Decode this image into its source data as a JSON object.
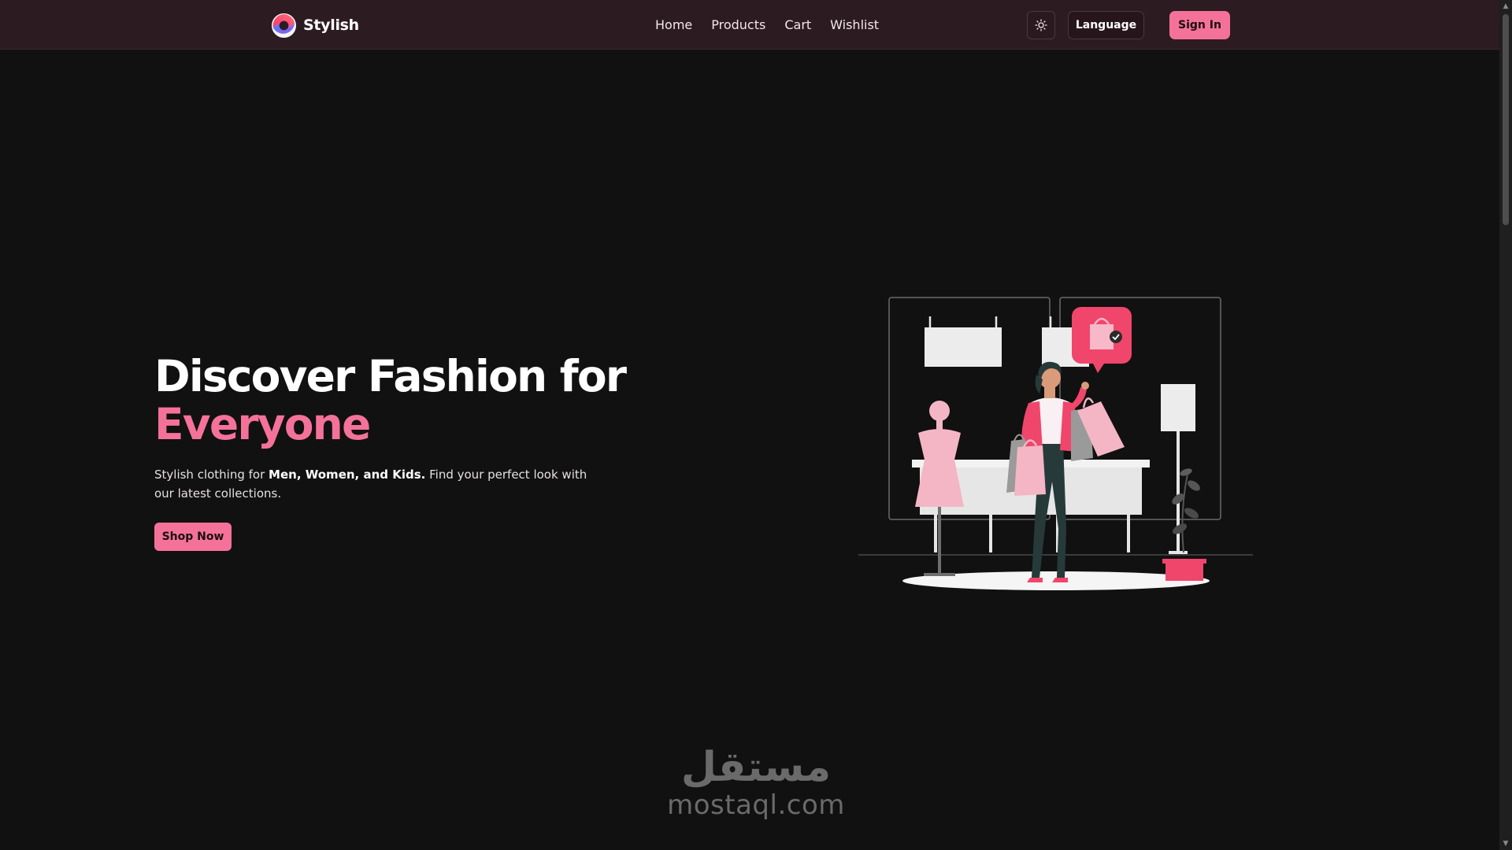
{
  "brand": {
    "name": "Stylish",
    "logo_icon": "stylish-logo-icon"
  },
  "nav": {
    "items": [
      {
        "label": "Home"
      },
      {
        "label": "Products"
      },
      {
        "label": "Cart"
      },
      {
        "label": "Wishlist"
      }
    ],
    "theme_toggle_icon": "sun-icon",
    "language_label": "Language",
    "signin_label": "Sign In"
  },
  "hero": {
    "title_line1": "Discover Fashion for",
    "title_line2": "Everyone",
    "desc_before": "Stylish clothing for ",
    "desc_bold": "Men, Women, and Kids.",
    "desc_after": " Find your perfect look with our latest collections.",
    "cta_label": "Shop Now",
    "illustration_icon": "shopping-woman-illustration"
  },
  "watermark": {
    "arabic": "مستقل",
    "latin": "mostaql.com"
  },
  "colors": {
    "accent": "#f4729a",
    "navbar_bg": "#2d1b22",
    "page_bg": "#111111"
  }
}
